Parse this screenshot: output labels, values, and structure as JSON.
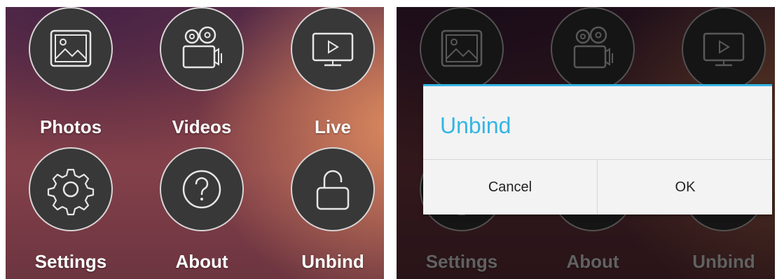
{
  "menu": {
    "photos": "Photos",
    "videos": "Videos",
    "live": "Live",
    "settings": "Settings",
    "about": "About",
    "unbind": "Unbind"
  },
  "dialog": {
    "title": "Unbind",
    "cancel": "Cancel",
    "ok": "OK"
  },
  "colors": {
    "accent": "#33b5e5",
    "circle": "#383838"
  },
  "icons": [
    "photo-icon",
    "video-camera-icon",
    "monitor-play-icon",
    "gear-icon",
    "help-icon",
    "unlock-icon"
  ]
}
